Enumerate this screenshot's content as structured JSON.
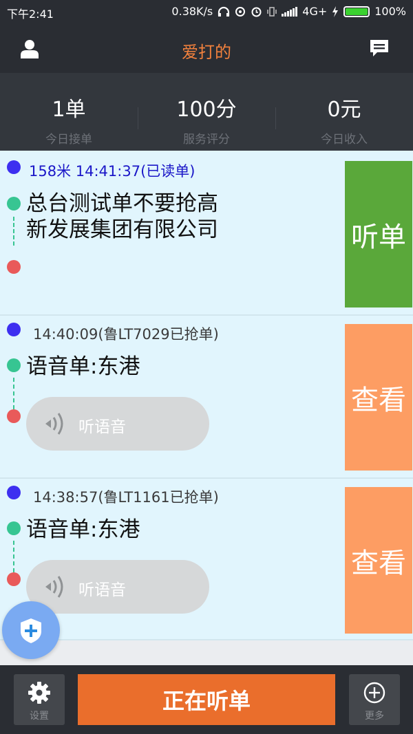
{
  "status_bar": {
    "time": "下午2:41",
    "speed": "0.38K/s",
    "network": "4G+",
    "battery": "100%"
  },
  "header": {
    "title": "爱打的",
    "left_icon": "user-icon",
    "right_icon": "message-icon"
  },
  "stats": [
    {
      "value": "1单",
      "label": "今日接单"
    },
    {
      "value": "100分",
      "label": "服务评分"
    },
    {
      "value": "0元",
      "label": "今日收入"
    }
  ],
  "orders": [
    {
      "meta": "158米 14:41:37(已读单)",
      "destination_line1": "总台测试单不要抢高",
      "destination_line2": "新发展集团有限公司",
      "action": "听单"
    },
    {
      "meta": "14:40:09(鲁LT7029已抢单)",
      "destination": "语音单:东港",
      "voice_label": "听语音",
      "action": "查看"
    },
    {
      "meta": "14:38:57(鲁LT1161已抢单)",
      "destination": "语音单:东港",
      "voice_label": "听语音",
      "action": "查看"
    }
  ],
  "fab": {
    "icon": "shield-plus-icon"
  },
  "bottom_bar": {
    "settings_label": "设置",
    "main_label": "正在听单",
    "more_label": "更多"
  },
  "colors": {
    "accent": "#ea6e2c",
    "title": "#f2813d",
    "listen_green": "#5aa83a",
    "view_orange": "#fd9d63",
    "order_bg": "#e1f5fd"
  }
}
